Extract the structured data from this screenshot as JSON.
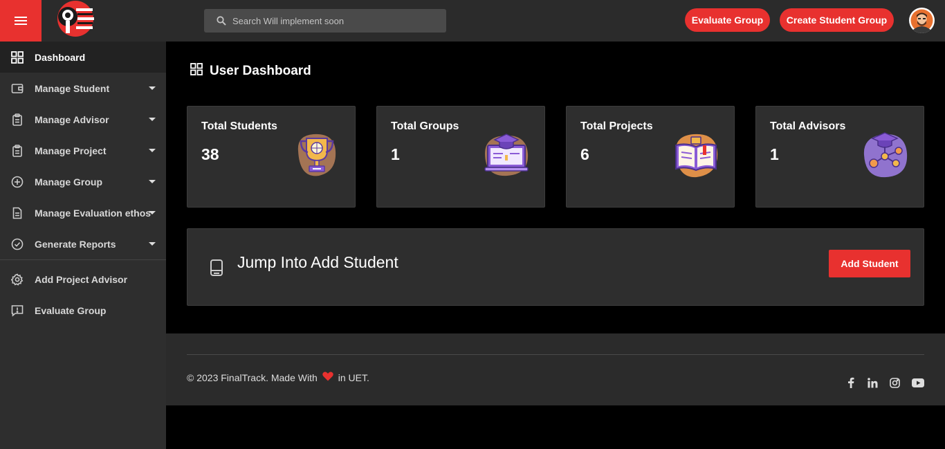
{
  "header": {
    "search_placeholder": "Search Will implement soon",
    "evaluate_group_label": "Evaluate Group",
    "create_group_label": "Create Student Group"
  },
  "sidebar": {
    "items": [
      {
        "label": "Dashboard",
        "icon": "dashboard-grid-icon",
        "active": true
      },
      {
        "label": "Manage Student",
        "icon": "wallet-icon",
        "dropdown": true
      },
      {
        "label": "Manage Advisor",
        "icon": "clipboard-icon",
        "dropdown": true
      },
      {
        "label": "Manage Project",
        "icon": "clipboard-icon",
        "dropdown": true
      },
      {
        "label": "Manage Group",
        "icon": "plus-circle-icon",
        "dropdown": true
      },
      {
        "label": "Manage Evaluation ethos",
        "icon": "document-icon",
        "dropdown": true
      },
      {
        "label": "Generate Reports",
        "icon": "check-circle-icon",
        "dropdown": true
      },
      {
        "label": "Add Project Advisor",
        "icon": "gear-icon"
      },
      {
        "label": "Evaluate Group",
        "icon": "feedback-icon"
      }
    ]
  },
  "main": {
    "title": "User Dashboard",
    "cards": [
      {
        "title": "Total Students",
        "value": "38",
        "icon": "trophy-icon"
      },
      {
        "title": "Total Groups",
        "value": "1",
        "icon": "laptop-graduation-cap-icon"
      },
      {
        "title": "Total Projects",
        "value": "6",
        "icon": "open-book-icon"
      },
      {
        "title": "Total Advisors",
        "value": "1",
        "icon": "graduation-cap-network-icon"
      }
    ],
    "jump": {
      "title": "Jump Into Add Student",
      "button_label": "Add Student"
    }
  },
  "footer": {
    "copyright_prefix": "© 2023 FinalTrack. Made With",
    "copyright_suffix": "in UET.",
    "social": [
      "facebook-icon",
      "linkedin-icon",
      "instagram-icon",
      "youtube-icon"
    ]
  },
  "colors": {
    "accent": "#e8312f",
    "panel": "#2e2e2e",
    "background": "#000000",
    "illustration_purple": "#8a5bd6",
    "illustration_orange": "#f2a04b"
  }
}
